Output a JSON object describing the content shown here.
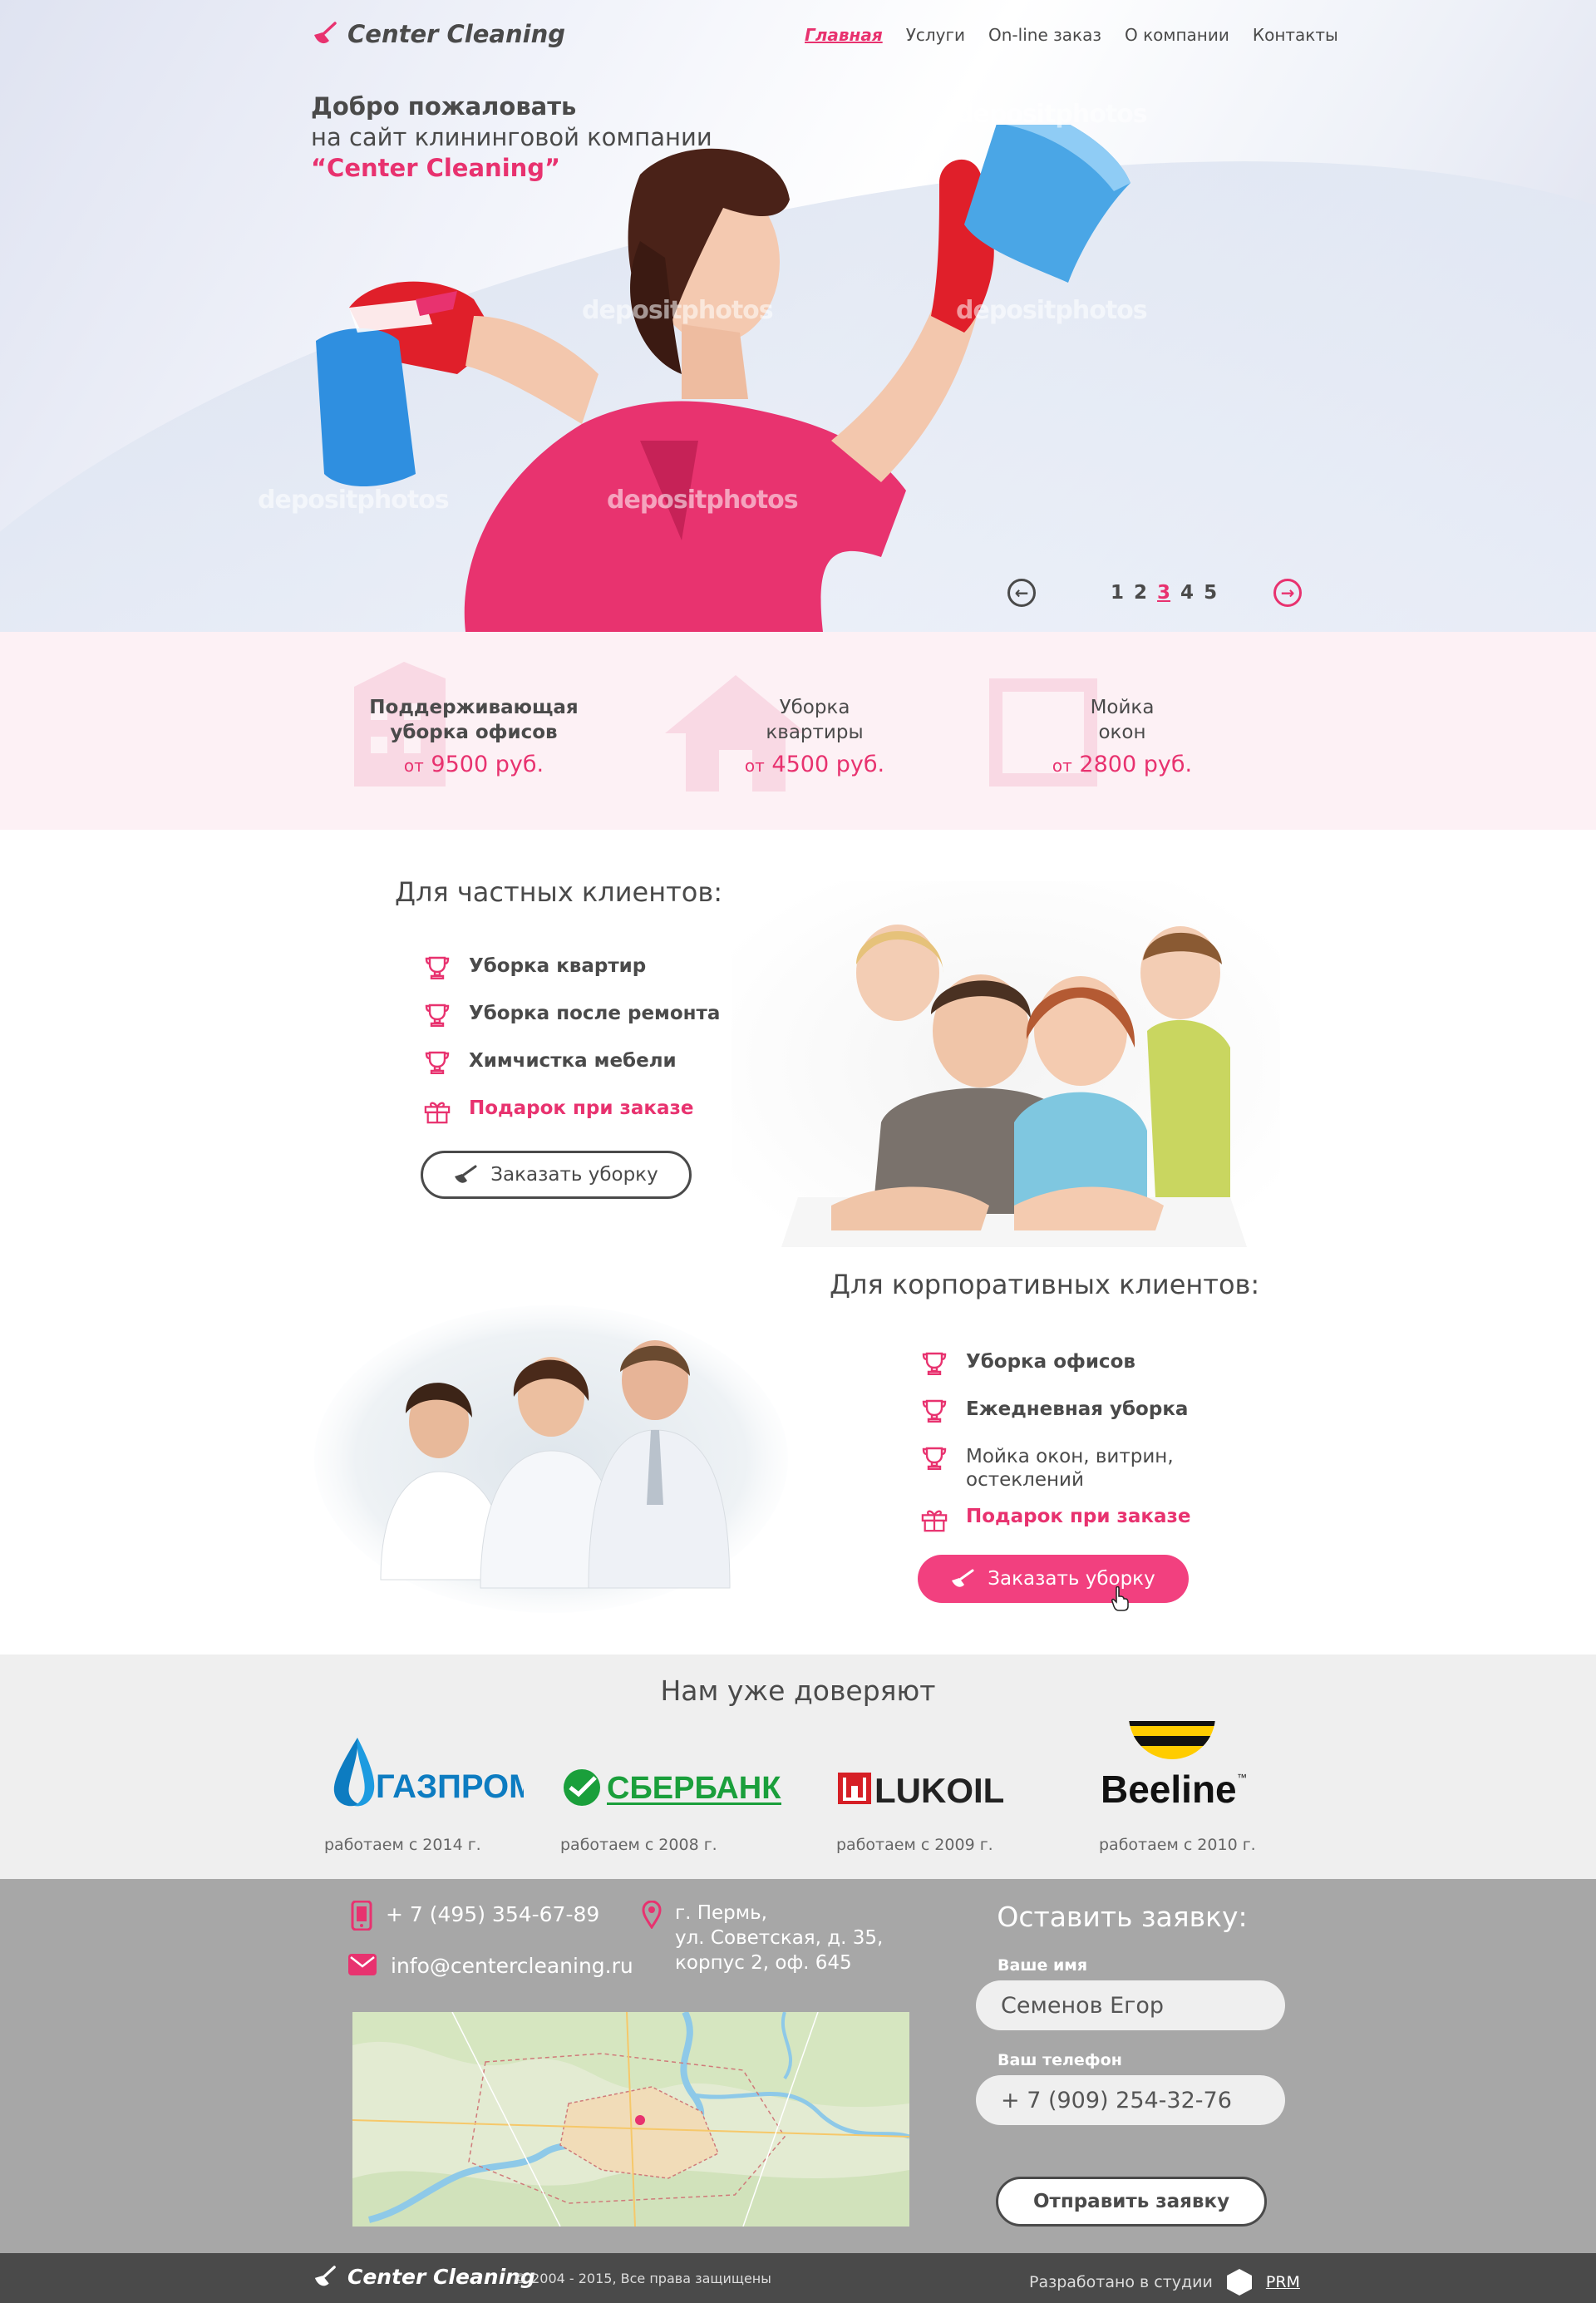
{
  "brand": {
    "name": "Center Cleaning",
    "accent": "#e8326f"
  },
  "nav": {
    "items": [
      {
        "label": "Главная",
        "active": true
      },
      {
        "label": "Услуги"
      },
      {
        "label": "On-line заказ"
      },
      {
        "label": "О компании"
      },
      {
        "label": "Контакты"
      }
    ]
  },
  "hero": {
    "line1": "Добро пожаловать",
    "line2": "на сайт клининговой компании",
    "line3": "“Center Cleaning”",
    "watermark": "depositphotos",
    "slider": {
      "pages": [
        "1",
        "2",
        "3",
        "4",
        "5"
      ],
      "current": 3,
      "prev_icon": "arrow-left-icon",
      "next_icon": "arrow-right-icon"
    }
  },
  "prices": [
    {
      "line1": "Поддерживающая",
      "line2": "уборка офисов",
      "from": "от",
      "price": "9500 руб.",
      "icon": "office-building-icon"
    },
    {
      "line1": "Уборка",
      "line2": "квартиры",
      "from": "от",
      "price": "4500 руб.",
      "icon": "house-icon"
    },
    {
      "line1": "Мойка",
      "line2": "окон",
      "from": "от",
      "price": "2800 руб.",
      "icon": "window-icon"
    }
  ],
  "private": {
    "title": "Для частных клиентов:",
    "items": [
      "Уборка квартир",
      "Уборка после ремонта",
      "Химчистка мебели"
    ],
    "gift": "Подарок при заказе",
    "button": "Заказать уборку"
  },
  "corporate": {
    "title": "Для корпоративных клиентов:",
    "items": [
      "Уборка офисов",
      "Ежедневная уборка"
    ],
    "item3_line1": "Мойка окон, витрин,",
    "item3_line2": "остеклений",
    "gift": "Подарок при заказе",
    "button": "Заказать уборку"
  },
  "trust": {
    "title": "Нам уже доверяют",
    "brands": [
      {
        "name": "ГАЗПРОМ",
        "since": "работаем с 2014 г.",
        "color": "#0d7cc1"
      },
      {
        "name": "СБЕРБАНК",
        "since": "работаем с 2008 г.",
        "color": "#1a9f3b"
      },
      {
        "name": "LUKOIL",
        "since": "работаем с 2009 г.",
        "color": "#d61f26"
      },
      {
        "name": "Beeline",
        "tm": "™",
        "since": "работаем с 2010 г.",
        "color": "#ffcc00"
      }
    ]
  },
  "contact": {
    "phone": "+ 7 (495) 354-67-89",
    "email": "info@centercleaning.ru",
    "address_line1": "г. Пермь,",
    "address_line2": "ул. Советская, д. 35,",
    "address_line3": "корпус 2, оф. 645"
  },
  "form": {
    "title": "Оставить заявку:",
    "name_label": "Ваше имя",
    "name_value": "Семенов Егор",
    "phone_label": "Ваш телефон",
    "phone_value": "+ 7 (909) 254-32-76",
    "submit": "Отправить заявку"
  },
  "footer": {
    "copyright": "© 2004 - 2015, Все права защищены",
    "developed": "Разработано в  студии",
    "studio": "PRM"
  }
}
